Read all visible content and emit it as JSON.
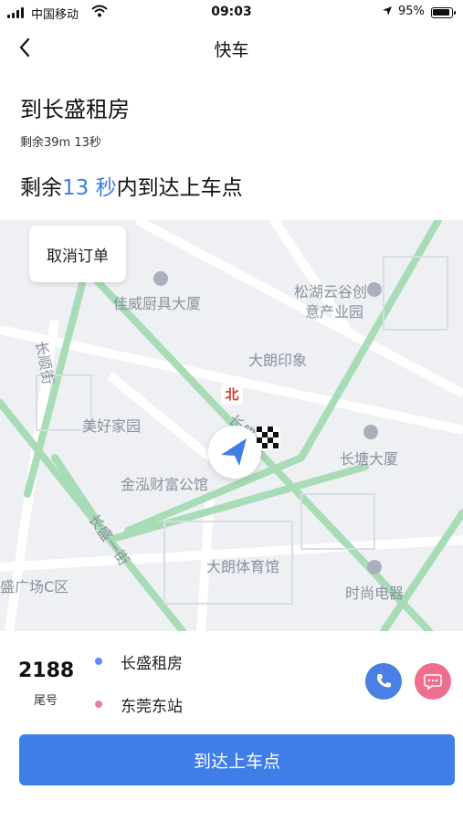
{
  "status_bar": {
    "carrier": "中国移动",
    "time": "09:03",
    "battery": "95%"
  },
  "nav": {
    "title": "快车",
    "back_icon": "chevron-left-icon"
  },
  "trip": {
    "destination_title": "到长盛租房",
    "remaining": "剩余39m 13秒",
    "eta_prefix": "剩余",
    "eta_value": "13 秒",
    "eta_suffix": "内到达上车点"
  },
  "map": {
    "cancel_label": "取消订单",
    "north_label": "北",
    "labels": {
      "jiawei": "佳威厨具大厦",
      "songhu_1": "松湖云谷创",
      "songhu_2": "意产业园",
      "dalang_yinxiang": "大朗印象",
      "meihao": "美好家园",
      "changtang": "长塘大厦",
      "jinhong": "金泓财富公馆",
      "dalang_tiyu": "大朗体育馆",
      "shishang": "时尚电器",
      "guangchang": "盛广场C区",
      "changshun_jie": "长顺街",
      "changsheng_yi_jie": "长盛一街",
      "chang_lu": "长盛路"
    }
  },
  "order": {
    "tail_number": "2188",
    "tail_label": "尾号",
    "from": "长盛租房",
    "to": "东莞东站",
    "from_color": "#5b8fe8",
    "to_color": "#e97f9c"
  },
  "action": {
    "main_button": "到达上车点"
  },
  "colors": {
    "accent": "#3f7de8",
    "call": "#4a7fe3",
    "message": "#ef6e90",
    "road": "#a8dcb6"
  }
}
